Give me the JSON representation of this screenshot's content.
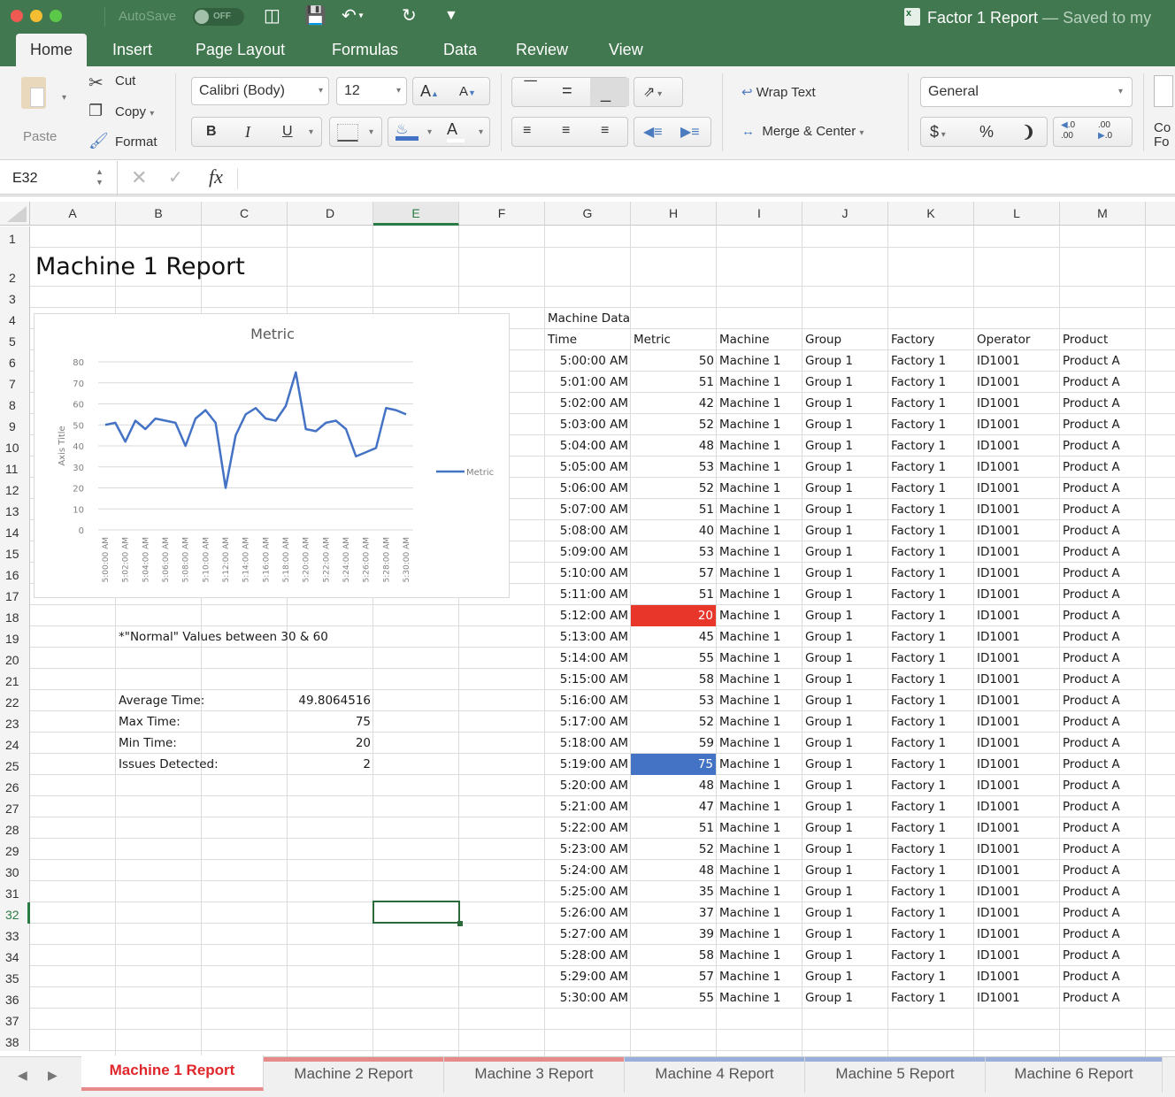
{
  "window": {
    "autosave_label": "AutoSave",
    "autosave_state": "OFF",
    "doc_title": "Factor 1 Report",
    "doc_subtitle": " — Saved to my"
  },
  "ribbon_tabs": [
    "Home",
    "Insert",
    "Page Layout",
    "Formulas",
    "Data",
    "Review",
    "View"
  ],
  "ribbon": {
    "paste": "Paste",
    "cut": "Cut",
    "copy": "Copy",
    "format": "Format",
    "font_name": "Calibri (Body)",
    "font_size": "12",
    "bold": "B",
    "italic": "I",
    "underline": "U",
    "wrap_text": "Wrap Text",
    "merge_center": "Merge & Center",
    "number_format": "General",
    "currency": "$",
    "percent": "%",
    "comma": "❩",
    "cond_format_partial_1": "Co",
    "cond_format_partial_2": "Fo"
  },
  "formula_bar": {
    "name_box": "E32",
    "fx": "fx",
    "formula": ""
  },
  "columns": [
    "A",
    "B",
    "C",
    "D",
    "E",
    "F",
    "G",
    "H",
    "I",
    "J",
    "K",
    "L",
    "M"
  ],
  "selected_column": "E",
  "selected_row": 32,
  "rows": [
    "1",
    "2",
    "3",
    "4",
    "5",
    "6",
    "7",
    "8",
    "9",
    "10",
    "11",
    "12",
    "13",
    "14",
    "15",
    "16",
    "17",
    "18",
    "19",
    "20",
    "21",
    "22",
    "23",
    "24",
    "25",
    "26",
    "27",
    "28",
    "29",
    "30",
    "31",
    "32",
    "33",
    "34",
    "35",
    "36",
    "37",
    "38"
  ],
  "sheet": {
    "title": "Machine 1 Report",
    "note": "*\"Normal\" Values between 30 & 60",
    "stats": [
      {
        "label": "Average Time:",
        "value": "49.8064516"
      },
      {
        "label": "Max Time:",
        "value": "75"
      },
      {
        "label": "Min Time:",
        "value": "20"
      },
      {
        "label": "Issues Detected:",
        "value": "2"
      }
    ],
    "table_title": "Machine Data",
    "headers": [
      "Time",
      "Metric",
      "Machine",
      "Group",
      "Factory",
      "Operator",
      "Product"
    ],
    "low_color": "#e8372a",
    "high_color": "#4472c4",
    "records": [
      [
        "5:00:00 AM",
        "50",
        "Machine 1",
        "Group 1",
        "Factory 1",
        "ID1001",
        "Product A"
      ],
      [
        "5:01:00 AM",
        "51",
        "Machine 1",
        "Group 1",
        "Factory 1",
        "ID1001",
        "Product A"
      ],
      [
        "5:02:00 AM",
        "42",
        "Machine 1",
        "Group 1",
        "Factory 1",
        "ID1001",
        "Product A"
      ],
      [
        "5:03:00 AM",
        "52",
        "Machine 1",
        "Group 1",
        "Factory 1",
        "ID1001",
        "Product A"
      ],
      [
        "5:04:00 AM",
        "48",
        "Machine 1",
        "Group 1",
        "Factory 1",
        "ID1001",
        "Product A"
      ],
      [
        "5:05:00 AM",
        "53",
        "Machine 1",
        "Group 1",
        "Factory 1",
        "ID1001",
        "Product A"
      ],
      [
        "5:06:00 AM",
        "52",
        "Machine 1",
        "Group 1",
        "Factory 1",
        "ID1001",
        "Product A"
      ],
      [
        "5:07:00 AM",
        "51",
        "Machine 1",
        "Group 1",
        "Factory 1",
        "ID1001",
        "Product A"
      ],
      [
        "5:08:00 AM",
        "40",
        "Machine 1",
        "Group 1",
        "Factory 1",
        "ID1001",
        "Product A"
      ],
      [
        "5:09:00 AM",
        "53",
        "Machine 1",
        "Group 1",
        "Factory 1",
        "ID1001",
        "Product A"
      ],
      [
        "5:10:00 AM",
        "57",
        "Machine 1",
        "Group 1",
        "Factory 1",
        "ID1001",
        "Product A"
      ],
      [
        "5:11:00 AM",
        "51",
        "Machine 1",
        "Group 1",
        "Factory 1",
        "ID1001",
        "Product A"
      ],
      [
        "5:12:00 AM",
        "20",
        "Machine 1",
        "Group 1",
        "Factory 1",
        "ID1001",
        "Product A"
      ],
      [
        "5:13:00 AM",
        "45",
        "Machine 1",
        "Group 1",
        "Factory 1",
        "ID1001",
        "Product A"
      ],
      [
        "5:14:00 AM",
        "55",
        "Machine 1",
        "Group 1",
        "Factory 1",
        "ID1001",
        "Product A"
      ],
      [
        "5:15:00 AM",
        "58",
        "Machine 1",
        "Group 1",
        "Factory 1",
        "ID1001",
        "Product A"
      ],
      [
        "5:16:00 AM",
        "53",
        "Machine 1",
        "Group 1",
        "Factory 1",
        "ID1001",
        "Product A"
      ],
      [
        "5:17:00 AM",
        "52",
        "Machine 1",
        "Group 1",
        "Factory 1",
        "ID1001",
        "Product A"
      ],
      [
        "5:18:00 AM",
        "59",
        "Machine 1",
        "Group 1",
        "Factory 1",
        "ID1001",
        "Product A"
      ],
      [
        "5:19:00 AM",
        "75",
        "Machine 1",
        "Group 1",
        "Factory 1",
        "ID1001",
        "Product A"
      ],
      [
        "5:20:00 AM",
        "48",
        "Machine 1",
        "Group 1",
        "Factory 1",
        "ID1001",
        "Product A"
      ],
      [
        "5:21:00 AM",
        "47",
        "Machine 1",
        "Group 1",
        "Factory 1",
        "ID1001",
        "Product A"
      ],
      [
        "5:22:00 AM",
        "51",
        "Machine 1",
        "Group 1",
        "Factory 1",
        "ID1001",
        "Product A"
      ],
      [
        "5:23:00 AM",
        "52",
        "Machine 1",
        "Group 1",
        "Factory 1",
        "ID1001",
        "Product A"
      ],
      [
        "5:24:00 AM",
        "48",
        "Machine 1",
        "Group 1",
        "Factory 1",
        "ID1001",
        "Product A"
      ],
      [
        "5:25:00 AM",
        "35",
        "Machine 1",
        "Group 1",
        "Factory 1",
        "ID1001",
        "Product A"
      ],
      [
        "5:26:00 AM",
        "37",
        "Machine 1",
        "Group 1",
        "Factory 1",
        "ID1001",
        "Product A"
      ],
      [
        "5:27:00 AM",
        "39",
        "Machine 1",
        "Group 1",
        "Factory 1",
        "ID1001",
        "Product A"
      ],
      [
        "5:28:00 AM",
        "58",
        "Machine 1",
        "Group 1",
        "Factory 1",
        "ID1001",
        "Product A"
      ],
      [
        "5:29:00 AM",
        "57",
        "Machine 1",
        "Group 1",
        "Factory 1",
        "ID1001",
        "Product A"
      ],
      [
        "5:30:00 AM",
        "55",
        "Machine 1",
        "Group 1",
        "Factory 1",
        "ID1001",
        "Product A"
      ]
    ]
  },
  "chart_data": {
    "type": "line",
    "title": "Metric",
    "xlabel": "",
    "ylabel": "Axis Title",
    "ylim": [
      0,
      80
    ],
    "yticks": [
      0,
      10,
      20,
      30,
      40,
      50,
      60,
      70,
      80
    ],
    "grid": true,
    "legend": "right",
    "line_color": "#4472c4",
    "x": [
      "5:00:00 AM",
      "5:01:00 AM",
      "5:02:00 AM",
      "5:03:00 AM",
      "5:04:00 AM",
      "5:05:00 AM",
      "5:06:00 AM",
      "5:07:00 AM",
      "5:08:00 AM",
      "5:09:00 AM",
      "5:10:00 AM",
      "5:11:00 AM",
      "5:12:00 AM",
      "5:13:00 AM",
      "5:14:00 AM",
      "5:15:00 AM",
      "5:16:00 AM",
      "5:17:00 AM",
      "5:18:00 AM",
      "5:19:00 AM",
      "5:20:00 AM",
      "5:21:00 AM",
      "5:22:00 AM",
      "5:23:00 AM",
      "5:24:00 AM",
      "5:25:00 AM",
      "5:26:00 AM",
      "5:27:00 AM",
      "5:28:00 AM",
      "5:29:00 AM",
      "5:30:00 AM"
    ],
    "x_tick_labels": [
      "5:00:00 AM",
      "5:02:00 AM",
      "5:04:00 AM",
      "5:06:00 AM",
      "5:08:00 AM",
      "5:10:00 AM",
      "5:12:00 AM",
      "5:14:00 AM",
      "5:16:00 AM",
      "5:18:00 AM",
      "5:20:00 AM",
      "5:22:00 AM",
      "5:24:00 AM",
      "5:26:00 AM",
      "5:28:00 AM",
      "5:30:00 AM"
    ],
    "series": [
      {
        "name": "Metric",
        "values": [
          50,
          51,
          42,
          52,
          48,
          53,
          52,
          51,
          40,
          53,
          57,
          51,
          20,
          45,
          55,
          58,
          53,
          52,
          59,
          75,
          48,
          47,
          51,
          52,
          48,
          35,
          37,
          39,
          58,
          57,
          55
        ]
      }
    ]
  },
  "sheet_tabs": [
    {
      "label": "Machine 1 Report",
      "active": true,
      "color": "#e88a8a"
    },
    {
      "label": "Machine 2 Report",
      "active": false,
      "color": "#e88a8a"
    },
    {
      "label": "Machine 3 Report",
      "active": false,
      "color": "#e88a8a"
    },
    {
      "label": "Machine 4 Report",
      "active": false,
      "color": "#9aaedc"
    },
    {
      "label": "Machine 5 Report",
      "active": false,
      "color": "#9aaedc"
    },
    {
      "label": "Machine 6 Report",
      "active": false,
      "color": "#9aaedc"
    }
  ]
}
